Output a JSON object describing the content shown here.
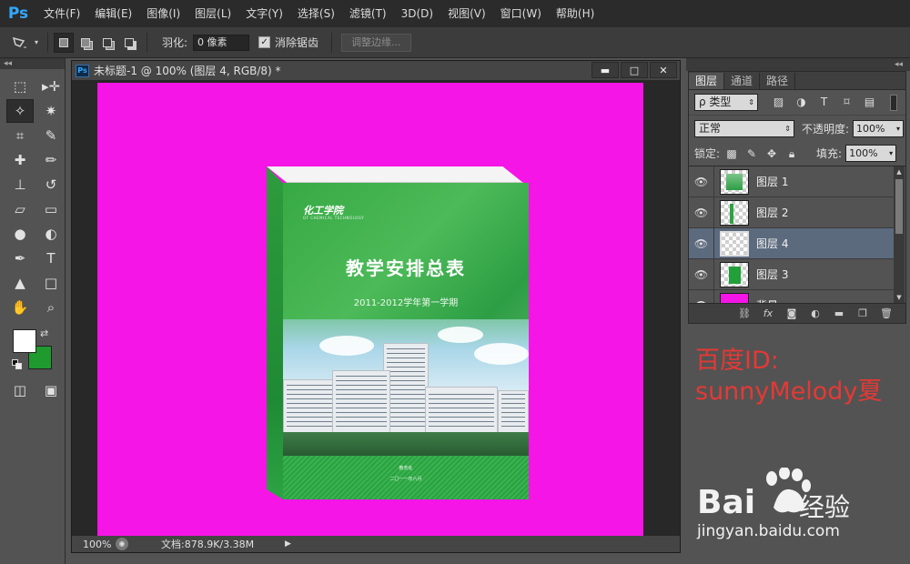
{
  "app": {
    "logo": "Ps",
    "menu": [
      "文件(F)",
      "编辑(E)",
      "图像(I)",
      "图层(L)",
      "文字(Y)",
      "选择(S)",
      "滤镜(T)",
      "3D(D)",
      "视图(V)",
      "窗口(W)",
      "帮助(H)"
    ]
  },
  "options": {
    "feather_label": "羽化:",
    "feather_value": "0 像素",
    "antialias_checked": "✓",
    "antialias_label": "消除锯齿",
    "refine_edge_label": "调整边缘..."
  },
  "toolbox": {
    "collapse": "◂◂",
    "tools": [
      {
        "name": "marquee-tool",
        "glyph": "⬚"
      },
      {
        "name": "move-tool",
        "glyph": "▸✛"
      },
      {
        "name": "polygonal-lasso-tool",
        "glyph": "✧",
        "active": true
      },
      {
        "name": "magic-wand-tool",
        "glyph": "✷"
      },
      {
        "name": "crop-tool",
        "glyph": "⌗"
      },
      {
        "name": "eyedropper-tool",
        "glyph": "✎"
      },
      {
        "name": "healing-brush-tool",
        "glyph": "✚"
      },
      {
        "name": "brush-tool",
        "glyph": "✏"
      },
      {
        "name": "clone-stamp-tool",
        "glyph": "⊥"
      },
      {
        "name": "history-brush-tool",
        "glyph": "↺"
      },
      {
        "name": "eraser-tool",
        "glyph": "▱"
      },
      {
        "name": "gradient-tool",
        "glyph": "▭"
      },
      {
        "name": "blur-tool",
        "glyph": "●"
      },
      {
        "name": "dodge-tool",
        "glyph": "◐"
      },
      {
        "name": "pen-tool",
        "glyph": "✒"
      },
      {
        "name": "type-tool",
        "glyph": "T"
      },
      {
        "name": "path-selection-tool",
        "glyph": "▲"
      },
      {
        "name": "rectangle-tool",
        "glyph": "□"
      },
      {
        "name": "hand-tool",
        "glyph": "✋"
      },
      {
        "name": "zoom-tool",
        "glyph": "⌕"
      }
    ],
    "foreground_color": "#ffffff",
    "background_color": "#1f9a2e"
  },
  "document": {
    "title": "未标题-1 @ 100% (图层 4, RGB/8) *",
    "minimize": "▬",
    "maximize": "□",
    "close": "✕",
    "canvas_color": "#f515e6",
    "zoom": "100%",
    "doc_size": "文档:878.9K/3.38M",
    "status_arrow": "▶"
  },
  "book": {
    "logo": "化工学院",
    "logo_sub": "OF CHEMICAL TECHNOLOGY",
    "title": "教学安排总表",
    "subtitle": "2011-2012学年第一学期",
    "footer_1": "教务处",
    "footer_2": "二〇一一年六月"
  },
  "layers_panel": {
    "collapse": "◂◂",
    "tabs": [
      "图层",
      "通道",
      "路径"
    ],
    "kind": "ρ 类型",
    "blend_mode": "正常",
    "opacity_label": "不透明度:",
    "opacity_value": "100%",
    "lock_label": "锁定:",
    "fill_label": "填充:",
    "fill_value": "100%",
    "layers": [
      {
        "name": "图层 1",
        "selected": false
      },
      {
        "name": "图层 2",
        "selected": false
      },
      {
        "name": "图层 4",
        "selected": true
      },
      {
        "name": "图层 3",
        "selected": false
      },
      {
        "name": "背景",
        "selected": false
      }
    ]
  },
  "overlay": {
    "line_1": "百度ID:",
    "line_2": "sunnyMelody夏"
  },
  "watermark": {
    "bai": "Bai",
    "du": "经验",
    "url": "jingyan.baidu.com"
  }
}
